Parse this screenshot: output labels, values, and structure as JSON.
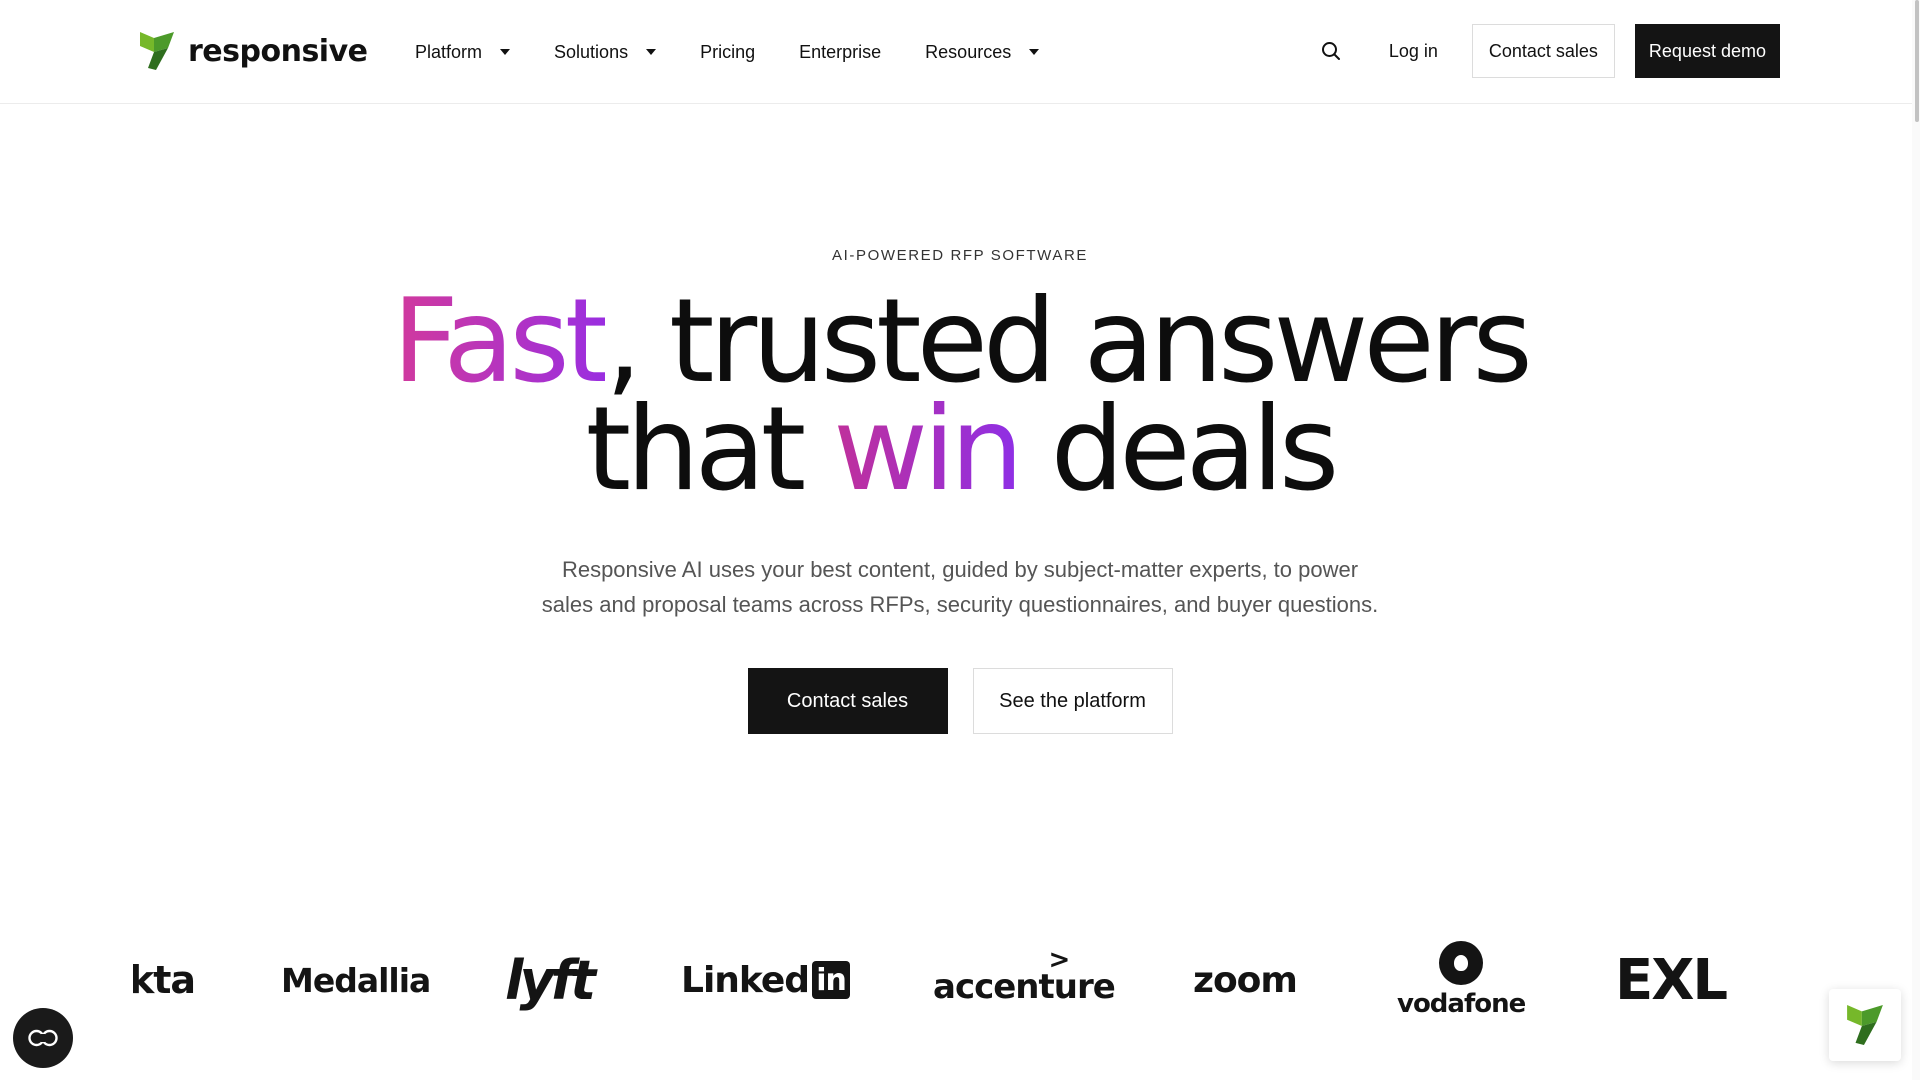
{
  "brand": {
    "name": "responsive",
    "accent": "#4c9a2a",
    "dark": "#141414",
    "gradient_start": "#d23a9c",
    "gradient_end": "#9a2ee0"
  },
  "nav": {
    "items": [
      {
        "label": "Platform",
        "has_dropdown": true
      },
      {
        "label": "Solutions",
        "has_dropdown": true
      },
      {
        "label": "Pricing",
        "has_dropdown": false
      },
      {
        "label": "Enterprise",
        "has_dropdown": false
      },
      {
        "label": "Resources",
        "has_dropdown": true
      }
    ],
    "search_icon": "search-icon",
    "login_label": "Log in",
    "contact_label": "Contact sales",
    "demo_label": "Request demo"
  },
  "hero": {
    "eyebrow": "AI-POWERED RFP SOFTWARE",
    "headline_fast": "Fast",
    "headline_rest1": ", trusted answers",
    "headline_that": "that ",
    "headline_win": "win",
    "headline_deals": " deals",
    "subtext_line1": "Responsive AI uses your best content, guided by subject-matter experts, to power",
    "subtext_line2": "sales and proposal teams across RFPs, security questionnaires, and buyer questions.",
    "cta_primary": "Contact sales",
    "cta_secondary": "See the platform"
  },
  "customer_logos": {
    "okta": "kta",
    "medallia": "Medallia",
    "lyft": "lyft",
    "linkedin_word": "Linked",
    "linkedin_box": "in",
    "accenture": "accenture",
    "accenture_mark": ">",
    "zoom": "zoom",
    "vodafone": "vodafone",
    "exl": "EXL"
  },
  "widgets": {
    "accessibility_icon": "accessibility-icon",
    "chat_icon": "responsive-logo-icon"
  }
}
